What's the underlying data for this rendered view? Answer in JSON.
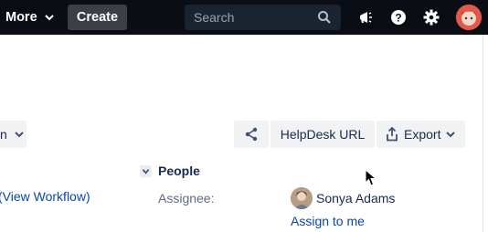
{
  "topbar": {
    "more_label": "More",
    "create_label": "Create",
    "search_placeholder": "Search",
    "icons": [
      "megaphone-icon",
      "help-icon",
      "settings-icon",
      "user-avatar"
    ]
  },
  "toolbar": {
    "left_dropdown_label": "n",
    "helpdesk_label": "HelpDesk URL",
    "export_label": "Export"
  },
  "details": {
    "view_workflow_label": "(View Workflow)",
    "cut_text": "l"
  },
  "people": {
    "header": "People",
    "assignee_label": "Assignee:",
    "assignee_name": "Sonya Adams",
    "assign_to_me": "Assign to me"
  },
  "colors": {
    "topbar_bg": "#0a0e14",
    "create_bg": "#3b4046",
    "link": "#0747a6",
    "button_bg": "#f1f2f4"
  }
}
